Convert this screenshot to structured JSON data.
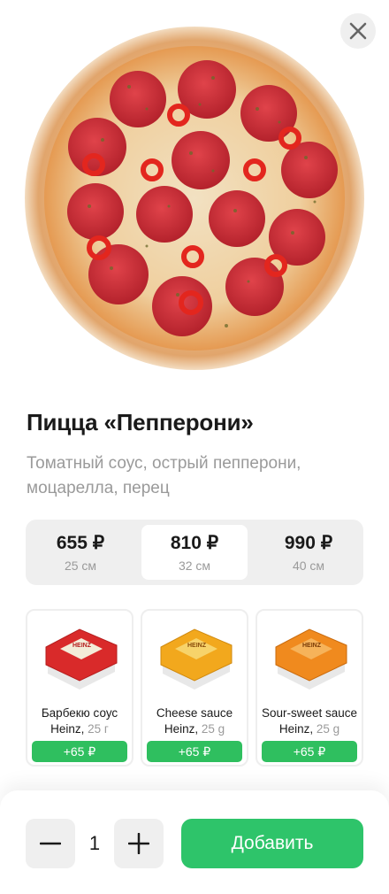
{
  "product": {
    "title": "Пицца «Пепперони»",
    "description": "Томатный соус, острый пепперони, моцарелла, перец"
  },
  "sizes": [
    {
      "price": "655 ₽",
      "size": "25 см",
      "selected": false
    },
    {
      "price": "810 ₽",
      "size": "32 см",
      "selected": true
    },
    {
      "price": "990 ₽",
      "size": "40 см",
      "selected": false
    }
  ],
  "sauces": [
    {
      "name": "Барбекю соус",
      "brand": "Heinz,",
      "weight": "25 г",
      "add_label": "+65 ₽",
      "color": "#d92a2a",
      "label_text": "HEINZ"
    },
    {
      "name": "Cheese sauce",
      "brand": "Heinz,",
      "weight": "25 g",
      "add_label": "+65 ₽",
      "color": "#f2a81d",
      "label_text": "HEINZ"
    },
    {
      "name": "Sour-sweet sauce",
      "brand": "Heinz,",
      "weight": "25 g",
      "add_label": "+65 ₽",
      "color": "#f08a1e",
      "label_text": "HEINZ"
    }
  ],
  "cart": {
    "quantity": "1",
    "add_button": "Добавить"
  },
  "icons": {
    "close": "close-icon",
    "minus": "minus-icon",
    "plus": "plus-icon"
  },
  "colors": {
    "accent": "#2ec46a",
    "chip_green": "#2fbf5f",
    "muted": "#9a9a9a"
  }
}
